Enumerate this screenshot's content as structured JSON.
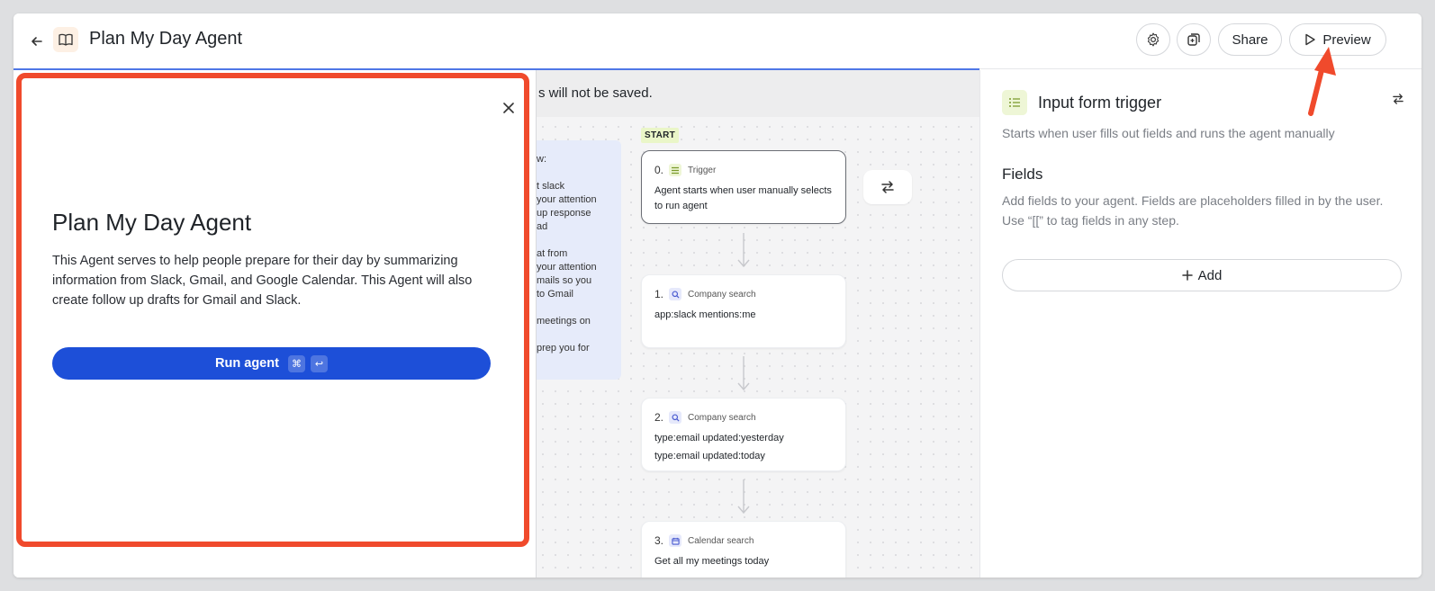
{
  "header": {
    "title": "Plan My Day Agent",
    "share_label": "Share",
    "preview_label": "Preview"
  },
  "modal": {
    "title": "Plan My Day Agent",
    "description": "This Agent serves to help people prepare for their day by summarizing information from Slack, Gmail, and Google Calendar. This Agent will also create follow up drafts for Gmail and Slack.",
    "run_label": "Run agent",
    "shortcut_cmd": "⌘",
    "shortcut_enter": "↩"
  },
  "canvas": {
    "banner_text": "s will not be saved.",
    "note_lines": [
      "w:",
      "",
      "t slack",
      "your attention",
      "up response",
      "ad",
      "",
      "at from",
      "your attention",
      "mails so you",
      "to Gmail",
      "",
      "meetings on",
      "",
      "prep you for"
    ],
    "start_tag": "START",
    "nodes": [
      {
        "num": "0.",
        "type": "Trigger",
        "lines": [
          "Agent starts when user manually selects to run agent"
        ]
      },
      {
        "num": "1.",
        "type": "Company search",
        "lines": [
          "app:slack mentions:me"
        ]
      },
      {
        "num": "2.",
        "type": "Company search",
        "lines": [
          "type:email updated:yesterday",
          "type:email updated:today"
        ]
      },
      {
        "num": "3.",
        "type": "Calendar search",
        "lines": [
          "Get all my meetings today"
        ]
      }
    ]
  },
  "panel": {
    "title": "Input form trigger",
    "description": "Starts when user fills out fields and runs the agent manually",
    "fields_heading": "Fields",
    "fields_description": "Add fields to your agent. Fields are placeholders filled in by the user. Use “[[” to tag fields in any step.",
    "add_label": "Add"
  },
  "colors": {
    "primary": "#1d4fd8",
    "highlight": "#f04a2c",
    "note_bg": "#e6ebfa",
    "trigger_icon_bg": "#eef6d6"
  }
}
